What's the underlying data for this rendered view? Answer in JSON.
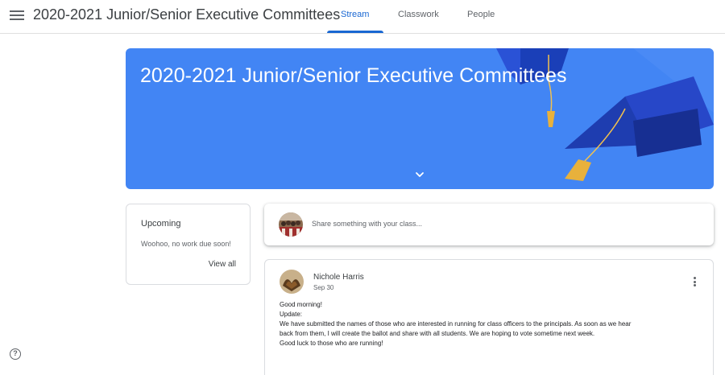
{
  "header": {
    "class_title": "2020-2021 Junior/Senior Executive Committees",
    "tabs": [
      {
        "label": "Stream",
        "active": true
      },
      {
        "label": "Classwork",
        "active": false
      },
      {
        "label": "People",
        "active": false
      }
    ]
  },
  "banner": {
    "title": "2020-2021 Junior/Senior Executive Committees",
    "color": "#4285f4"
  },
  "upcoming": {
    "title": "Upcoming",
    "empty_text": "Woohoo, no work due soon!",
    "view_all": "View all"
  },
  "share": {
    "placeholder": "Share something with your class..."
  },
  "post": {
    "author": "Nichole Harris",
    "date": "Sep 30",
    "lines": [
      "Good morning!",
      "Update:",
      "We have submitted the names of those who are interested in running for class officers to the principals.  As soon as we hear",
      "back from them, I will create the ballot and share with all students.  We are hoping to vote sometime next week.",
      "Good luck to those who are running!"
    ]
  },
  "icons": {
    "menu": "hamburger-menu-icon",
    "chevron": "chevron-down-icon",
    "more": "more-vert-icon",
    "help": "help-icon"
  },
  "colors": {
    "accent": "#1967d2",
    "banner": "#4285f4"
  }
}
